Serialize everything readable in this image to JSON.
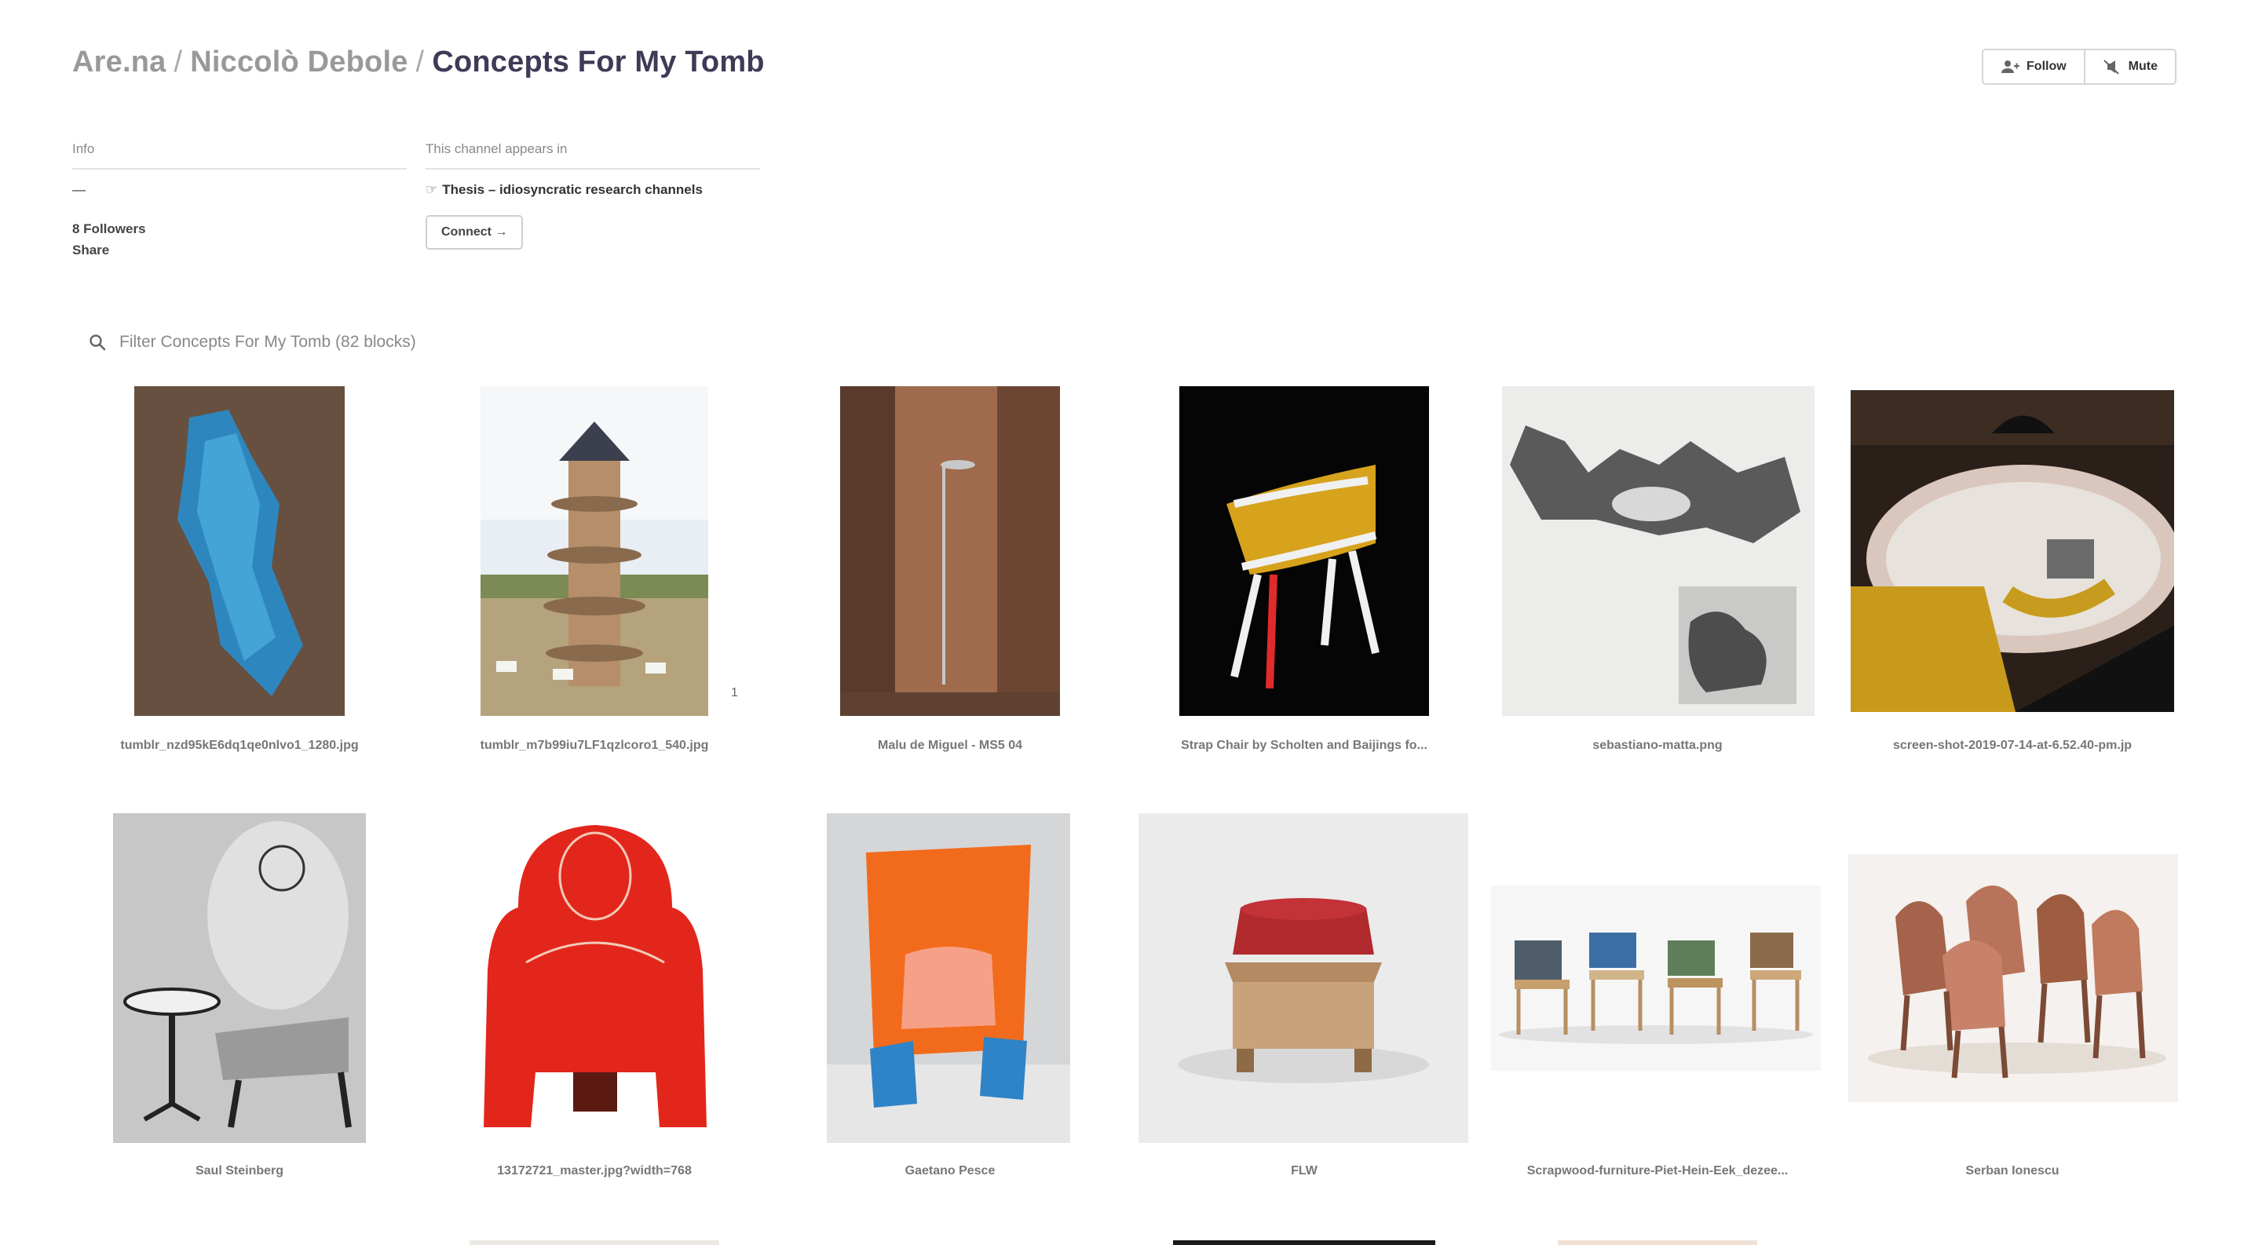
{
  "breadcrumb": {
    "site": "Are.na",
    "sep1": "/",
    "user": "Niccolò Debole",
    "sep2": "/",
    "channel": "Concepts For My Tomb"
  },
  "actions": {
    "follow_label": "Follow",
    "mute_label": "Mute"
  },
  "info": {
    "label": "Info",
    "description": "—",
    "followers": "8 Followers",
    "share": "Share"
  },
  "appears_in": {
    "label": "This channel appears in",
    "hand": "☞",
    "channel": "Thesis – idiosyncratic research channels",
    "connect_label": "Connect →"
  },
  "filter": {
    "placeholder": "Filter Concepts For My Tomb (82 blocks)"
  },
  "blocks": [
    {
      "title": "tumblr_nzd95kE6dq1qe0nlvo1_1280.jpg"
    },
    {
      "title": "tumblr_m7b99iu7LF1qzlcoro1_540.jpg",
      "badge": "1"
    },
    {
      "title": "Malu de Miguel - MS5 04"
    },
    {
      "title": "Strap Chair by Scholten and Baijings fo..."
    },
    {
      "title": "sebastiano-matta.png"
    },
    {
      "title": "screen-shot-2019-07-14-at-6.52.40-pm.jp"
    },
    {
      "title": "Saul Steinberg"
    },
    {
      "title": "13172721_master.jpg?width=768"
    },
    {
      "title": "Gaetano Pesce"
    },
    {
      "title": "FLW"
    },
    {
      "title": "Scrapwood-furniture-Piet-Hein-Eek_dezee..."
    },
    {
      "title": "Serban Ionescu"
    }
  ]
}
